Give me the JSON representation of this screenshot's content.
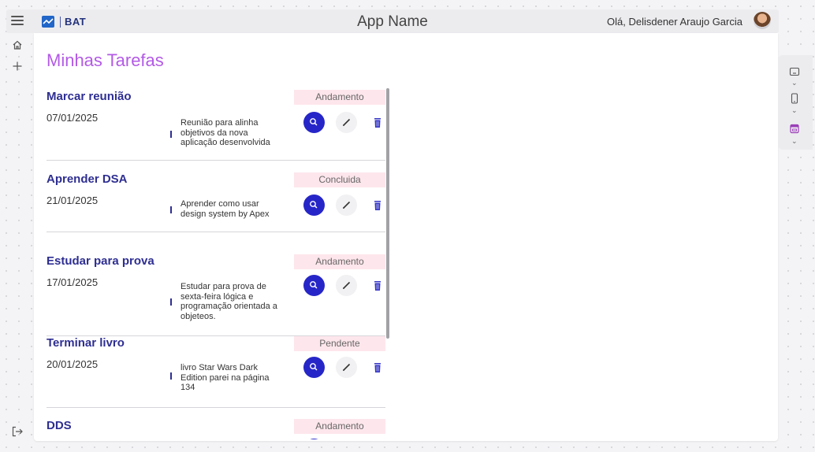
{
  "header": {
    "logo_text": "BAT",
    "app_name": "App Name",
    "greeting": "Olá, Delisdener Araujo Garcia"
  },
  "icons": {
    "menu": "hamburger-icon",
    "home": "home-icon",
    "add": "plus-icon",
    "logout": "logout-icon",
    "view": "search-icon",
    "edit": "pencil-icon",
    "delete": "trash-icon"
  },
  "colors": {
    "title_purple": "#b35ae6",
    "task_title_blue": "#2e2e92",
    "primary_button": "#2626c8",
    "status_bg": "#fde6ec"
  },
  "main": {
    "page_title": "Minhas Tarefas",
    "tasks": [
      {
        "title": "Marcar reunião",
        "date": "07/01/2025",
        "description": [
          "Reunião para alinha",
          "objetivos da nova",
          "aplicação desenvolvida"
        ],
        "status": "Andamento"
      },
      {
        "title": "Aprender DSA",
        "date": "21/01/2025",
        "description": [
          "Aprender como usar",
          "design system by Apex"
        ],
        "status": "Concluida"
      },
      {
        "title": "Estudar para prova",
        "date": "17/01/2025",
        "description": [
          "Estudar para prova de",
          "sexta-feira lógica e",
          "programação orientada a",
          "objeteos."
        ],
        "status": "Andamento"
      },
      {
        "title": "Terminar livro",
        "date": "20/01/2025",
        "description": [
          "livro Star Wars Dark",
          "Edition parei na página",
          "134"
        ],
        "status": "Pendente"
      },
      {
        "title": "DDS",
        "date": "",
        "description": [],
        "status": "Andamento"
      }
    ]
  }
}
